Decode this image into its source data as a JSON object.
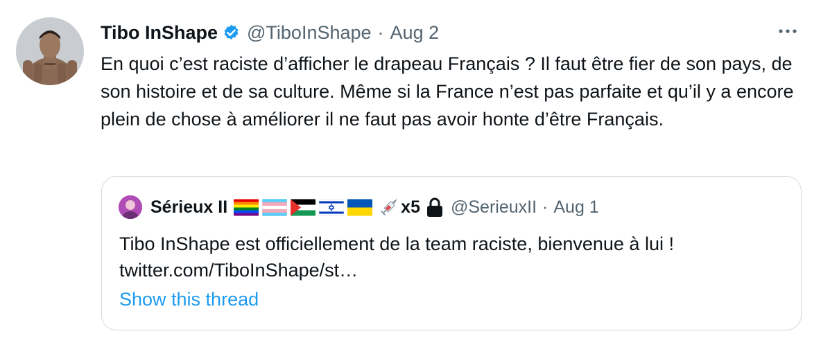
{
  "tweet": {
    "display_name": "Tibo InShape",
    "handle": "@TiboInShape",
    "separator": "·",
    "date": "Aug 2",
    "text": "En quoi c’est raciste d’afficher le drapeau Français ? Il faut être fier de son pays, de son histoire et de sa culture. Même si la France n’est pas parfaite et qu’il y a encore plein de chose à améliorer il ne faut pas avoir honte d’être Français.",
    "more_icon": "more-horizontal-icon",
    "verified_icon": "verified-badge-icon"
  },
  "quoted_tweet": {
    "display_name": "Sérieux II",
    "flags": [
      "rainbow-flag-icon",
      "transgender-flag-icon",
      "palestine-flag-icon",
      "israel-flag-icon",
      "ukraine-flag-icon"
    ],
    "syringe_icon": "syringe-icon",
    "vaccine_count": "x5",
    "lock_icon": "lock-icon",
    "handle": "@SerieuxII",
    "separator": "·",
    "date": "Aug 1",
    "text_line1": "Tibo InShape est officiellement de la team raciste, bienvenue à lui !",
    "text_line2": "twitter.com/TiboInShape/st…",
    "show_thread": "Show this thread"
  },
  "colors": {
    "text_primary": "#0f1419",
    "text_secondary": "#536471",
    "link": "#1d9bf0",
    "border": "#cfd9de",
    "verified": "#1d9bf0"
  }
}
